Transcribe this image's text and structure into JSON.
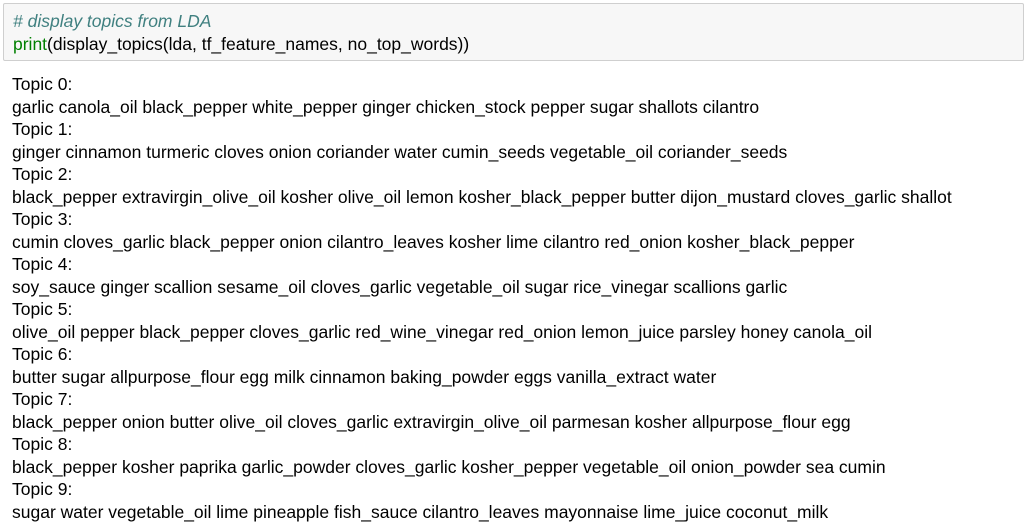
{
  "input_cell": {
    "comment": "# display topics from LDA",
    "builtin": "print",
    "call": "(display_topics(lda, tf_feature_names, no_top_words))"
  },
  "output": {
    "topics": [
      {
        "header": "Topic 0:",
        "words": "garlic canola_oil black_pepper white_pepper ginger chicken_stock pepper sugar shallots cilantro"
      },
      {
        "header": "Topic 1:",
        "words": "ginger cinnamon turmeric cloves onion coriander water cumin_seeds vegetable_oil coriander_seeds"
      },
      {
        "header": "Topic 2:",
        "words": "black_pepper extravirgin_olive_oil kosher olive_oil lemon kosher_black_pepper butter dijon_mustard cloves_garlic shallot"
      },
      {
        "header": "Topic 3:",
        "words": "cumin cloves_garlic black_pepper onion cilantro_leaves kosher lime cilantro red_onion kosher_black_pepper"
      },
      {
        "header": "Topic 4:",
        "words": "soy_sauce ginger scallion sesame_oil cloves_garlic vegetable_oil sugar rice_vinegar scallions garlic"
      },
      {
        "header": "Topic 5:",
        "words": "olive_oil pepper black_pepper cloves_garlic red_wine_vinegar red_onion lemon_juice parsley honey canola_oil"
      },
      {
        "header": "Topic 6:",
        "words": "butter sugar allpurpose_flour egg milk cinnamon baking_powder eggs vanilla_extract water"
      },
      {
        "header": "Topic 7:",
        "words": "black_pepper onion butter olive_oil cloves_garlic extravirgin_olive_oil parmesan kosher allpurpose_flour egg"
      },
      {
        "header": "Topic 8:",
        "words": "black_pepper kosher paprika garlic_powder cloves_garlic kosher_pepper vegetable_oil onion_powder sea cumin"
      },
      {
        "header": "Topic 9:",
        "words": "sugar water vegetable_oil lime pineapple fish_sauce cilantro_leaves mayonnaise lime_juice coconut_milk"
      }
    ]
  }
}
